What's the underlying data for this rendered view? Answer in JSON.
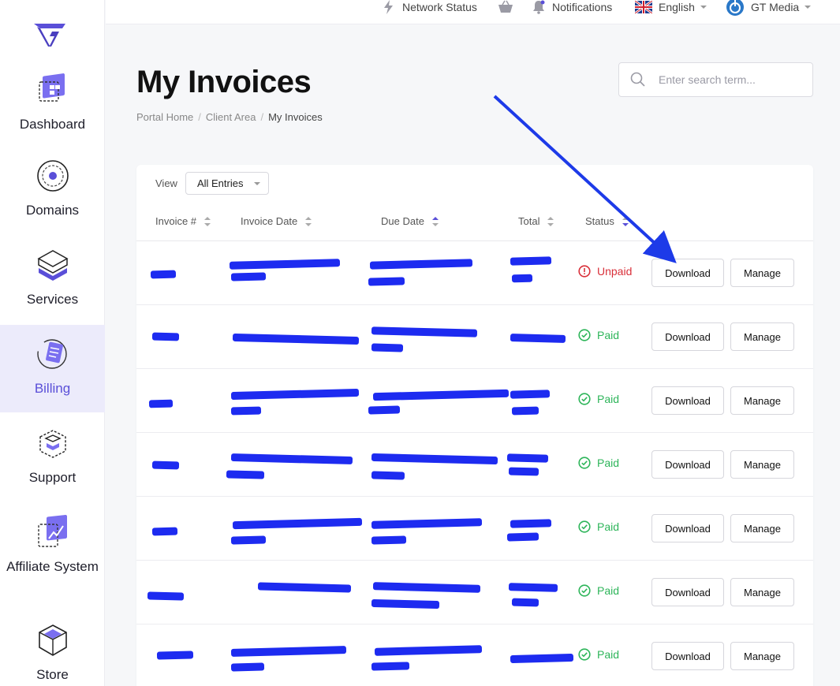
{
  "sidebar": {
    "items": [
      {
        "label": "Dashboard",
        "icon": "dashboard-icon"
      },
      {
        "label": "Domains",
        "icon": "globe-icon"
      },
      {
        "label": "Services",
        "icon": "layers-icon"
      },
      {
        "label": "Billing",
        "icon": "billing-icon",
        "active": true
      },
      {
        "label": "Support",
        "icon": "support-box-icon"
      },
      {
        "label": "Affiliate System",
        "icon": "affiliate-chart-icon"
      },
      {
        "label": "Store",
        "icon": "store-cube-icon"
      }
    ]
  },
  "topbar": {
    "network_status": "Network Status",
    "notifications": "Notifications",
    "language": "English",
    "account": "GT Media"
  },
  "page": {
    "title": "My Invoices",
    "breadcrumb": [
      "Portal Home",
      "Client Area",
      "My Invoices"
    ],
    "search_placeholder": "Enter search term..."
  },
  "table": {
    "view_label": "View",
    "view_value": "All Entries",
    "columns": [
      "Invoice #",
      "Invoice Date",
      "Due Date",
      "Total",
      "Status"
    ],
    "download_label": "Download",
    "manage_label": "Manage",
    "rows": [
      {
        "status": "Unpaid"
      },
      {
        "status": "Paid"
      },
      {
        "status": "Paid"
      },
      {
        "status": "Paid"
      },
      {
        "status": "Paid"
      },
      {
        "status": "Paid"
      },
      {
        "status": "Paid"
      }
    ]
  },
  "colors": {
    "accent": "#5a4fd8",
    "paid": "#2eb55a",
    "unpaid": "#d9303a",
    "redaction": "#1d2bf0",
    "annotation_arrow": "#1d3ae8"
  }
}
